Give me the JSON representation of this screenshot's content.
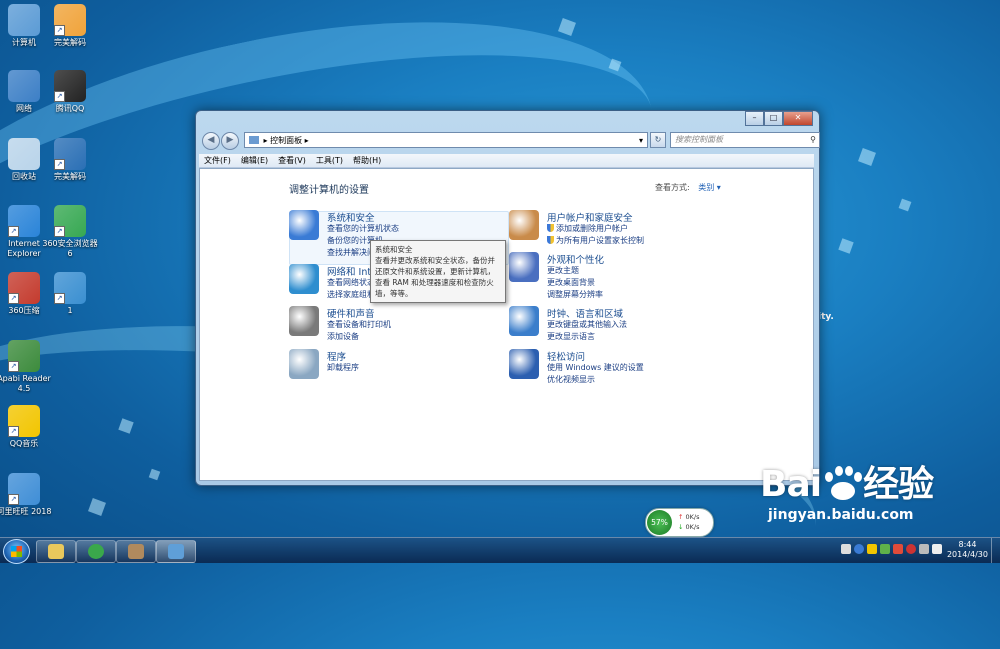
{
  "desktop": {
    "icons": [
      {
        "label": "计算机",
        "color": "#5b9bd5"
      },
      {
        "label": "完美解码",
        "color": "#f0a33a"
      },
      {
        "label": "网络",
        "color": "#3c7fc6"
      },
      {
        "label": "腾讯QQ",
        "color": "#222222"
      },
      {
        "label": "回收站",
        "color": "#b9d4ea"
      },
      {
        "label": "完美解码",
        "color": "#2a6fb5"
      },
      {
        "label": "Internet Explorer",
        "color": "#2a84d8"
      },
      {
        "label": "360安全浏览器6",
        "color": "#36a852"
      },
      {
        "label": "360压缩",
        "color": "#c43b2e"
      },
      {
        "label": "1",
        "color": "#3a8fd1"
      },
      {
        "label": "Apabi Reader 4.5",
        "color": "#3c8b3c"
      },
      {
        "label": "QQ音乐",
        "color": "#f2c500"
      },
      {
        "label": "阿里旺旺 2018",
        "color": "#3f8ed6"
      }
    ],
    "stray_text": "ity."
  },
  "window": {
    "address": "控制面板",
    "search_placeholder": "搜索控制面板",
    "menu": [
      "文件(F)",
      "编辑(E)",
      "查看(V)",
      "工具(T)",
      "帮助(H)"
    ],
    "page_title": "调整计算机的设置",
    "view_by_label": "查看方式:",
    "view_by_value": "类别 ▾",
    "categories_left": [
      {
        "title": "系统和安全",
        "links": [
          "查看您的计算机状态",
          "备份您的计算机",
          "查找并解决问题"
        ],
        "color": "#3a7bd5"
      },
      {
        "title": "网络和 Internet",
        "links": [
          "查看网络状态和任务",
          "选择家庭组和共享选项"
        ],
        "color": "#2f8ecf"
      },
      {
        "title": "硬件和声音",
        "links": [
          "查看设备和打印机",
          "添加设备"
        ],
        "color": "#7a7a7a"
      },
      {
        "title": "程序",
        "links": [
          "卸载程序"
        ],
        "color": "#8aa7c2"
      }
    ],
    "categories_right": [
      {
        "title": "用户帐户和家庭安全",
        "links": [
          "添加或删除用户帐户",
          "为所有用户设置家长控制"
        ],
        "color": "#c98b4a"
      },
      {
        "title": "外观和个性化",
        "links": [
          "更改主题",
          "更改桌面背景",
          "调整屏幕分辨率"
        ],
        "color": "#4a6fc0"
      },
      {
        "title": "时钟、语言和区域",
        "links": [
          "更改键盘或其他输入法",
          "更改显示语言"
        ],
        "color": "#3b7ecb"
      },
      {
        "title": "轻松访问",
        "links": [
          "使用 Windows 建议的设置",
          "优化视频显示"
        ],
        "color": "#2c5fb0"
      }
    ],
    "tooltip": {
      "title": "系统和安全",
      "body": "查看并更改系统和安全状态，备份并还原文件和系统设置，更新计算机，查看 RAM 和处理器速度和检查防火墙，等等。"
    }
  },
  "netwidget": {
    "percent": "57%",
    "up": "0K/s",
    "down": "0K/s"
  },
  "taskbar": {
    "time": "8:44",
    "date": "2014/4/30"
  },
  "watermark": {
    "text": "Bai",
    "text2": "经验",
    "url": "jingyan.baidu.com"
  }
}
